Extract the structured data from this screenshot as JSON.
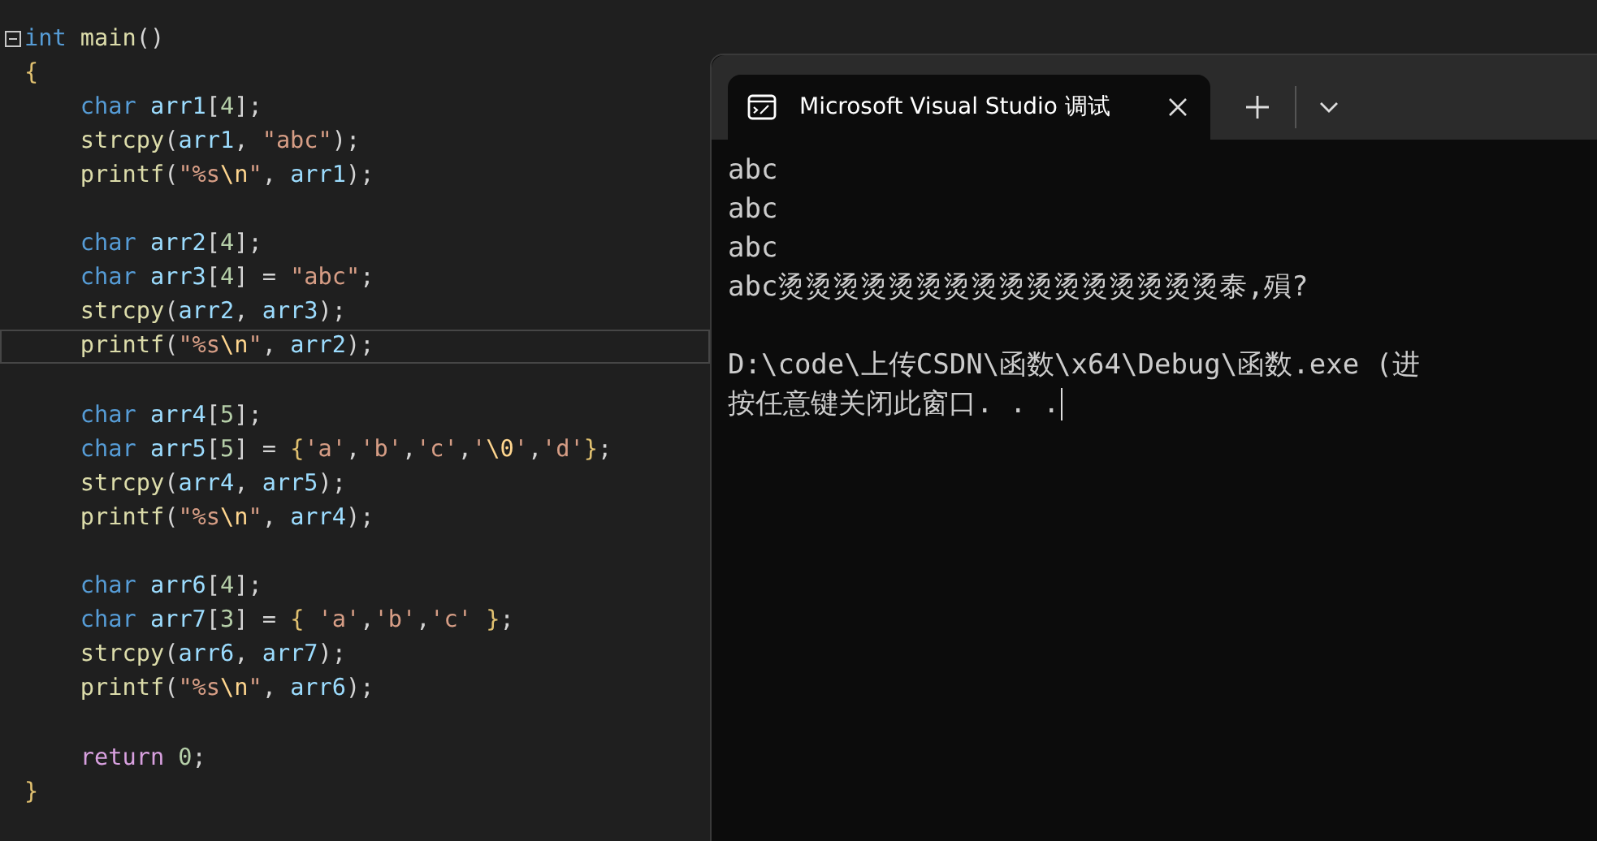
{
  "editor": {
    "lines": [
      {
        "expanded": true,
        "current": false,
        "tokens": [
          {
            "kind": "kw",
            "text": "int"
          },
          {
            "kind": "fn",
            "text": " main"
          },
          {
            "kind": "punc",
            "text": "()"
          }
        ]
      },
      {
        "current": false,
        "tokens": [
          {
            "kind": "brace",
            "text": "{"
          }
        ]
      },
      {
        "current": false,
        "tokens": [
          {
            "kind": "kw",
            "text": "    char"
          },
          {
            "kind": "var",
            "text": " arr1"
          },
          {
            "kind": "punc",
            "text": "["
          },
          {
            "kind": "num",
            "text": "4"
          },
          {
            "kind": "punc",
            "text": "];"
          }
        ]
      },
      {
        "current": false,
        "tokens": [
          {
            "kind": "fn",
            "text": "    strcpy"
          },
          {
            "kind": "punc",
            "text": "("
          },
          {
            "kind": "var",
            "text": "arr1"
          },
          {
            "kind": "punc",
            "text": ", "
          },
          {
            "kind": "str",
            "text": "\"abc\""
          },
          {
            "kind": "punc",
            "text": ");"
          }
        ]
      },
      {
        "current": false,
        "tokens": [
          {
            "kind": "fn",
            "text": "    printf"
          },
          {
            "kind": "punc",
            "text": "("
          },
          {
            "kind": "str",
            "text": "\"%s"
          },
          {
            "kind": "esc",
            "text": "\\n"
          },
          {
            "kind": "str",
            "text": "\""
          },
          {
            "kind": "punc",
            "text": ", "
          },
          {
            "kind": "var",
            "text": "arr1"
          },
          {
            "kind": "punc",
            "text": ");"
          }
        ]
      },
      {
        "current": false
      },
      {
        "current": false,
        "tokens": [
          {
            "kind": "kw",
            "text": "    char"
          },
          {
            "kind": "var",
            "text": " arr2"
          },
          {
            "kind": "punc",
            "text": "["
          },
          {
            "kind": "num",
            "text": "4"
          },
          {
            "kind": "punc",
            "text": "];"
          }
        ]
      },
      {
        "current": false,
        "tokens": [
          {
            "kind": "kw",
            "text": "    char"
          },
          {
            "kind": "var",
            "text": " arr3"
          },
          {
            "kind": "punc",
            "text": "["
          },
          {
            "kind": "num",
            "text": "4"
          },
          {
            "kind": "punc",
            "text": "] = "
          },
          {
            "kind": "str",
            "text": "\"abc\""
          },
          {
            "kind": "punc",
            "text": ";"
          }
        ]
      },
      {
        "current": false,
        "tokens": [
          {
            "kind": "fn",
            "text": "    strcpy"
          },
          {
            "kind": "punc",
            "text": "("
          },
          {
            "kind": "var",
            "text": "arr2"
          },
          {
            "kind": "punc",
            "text": ", "
          },
          {
            "kind": "var",
            "text": "arr3"
          },
          {
            "kind": "punc",
            "text": ");"
          }
        ]
      },
      {
        "current": true,
        "tokens": [
          {
            "kind": "fn",
            "text": "    printf"
          },
          {
            "kind": "punc",
            "text": "("
          },
          {
            "kind": "str",
            "text": "\"%s"
          },
          {
            "kind": "esc",
            "text": "\\n"
          },
          {
            "kind": "str",
            "text": "\""
          },
          {
            "kind": "punc",
            "text": ", "
          },
          {
            "kind": "var",
            "text": "arr2"
          },
          {
            "kind": "punc",
            "text": ");"
          }
        ]
      },
      {
        "current": false
      },
      {
        "current": false,
        "tokens": [
          {
            "kind": "kw",
            "text": "    char"
          },
          {
            "kind": "var",
            "text": " arr4"
          },
          {
            "kind": "punc",
            "text": "["
          },
          {
            "kind": "num",
            "text": "5"
          },
          {
            "kind": "punc",
            "text": "];"
          }
        ]
      },
      {
        "current": false,
        "tokens": [
          {
            "kind": "kw",
            "text": "    char"
          },
          {
            "kind": "var",
            "text": " arr5"
          },
          {
            "kind": "punc",
            "text": "["
          },
          {
            "kind": "num",
            "text": "5"
          },
          {
            "kind": "punc",
            "text": "] = "
          },
          {
            "kind": "brace",
            "text": "{"
          },
          {
            "kind": "str",
            "text": "'a'"
          },
          {
            "kind": "punc",
            "text": ","
          },
          {
            "kind": "str",
            "text": "'b'"
          },
          {
            "kind": "punc",
            "text": ","
          },
          {
            "kind": "str",
            "text": "'c'"
          },
          {
            "kind": "punc",
            "text": ","
          },
          {
            "kind": "str",
            "text": "'"
          },
          {
            "kind": "esc",
            "text": "\\0"
          },
          {
            "kind": "str",
            "text": "'"
          },
          {
            "kind": "punc",
            "text": ","
          },
          {
            "kind": "str",
            "text": "'d'"
          },
          {
            "kind": "brace",
            "text": "}"
          },
          {
            "kind": "punc",
            "text": ";"
          }
        ]
      },
      {
        "current": false,
        "tokens": [
          {
            "kind": "fn",
            "text": "    strcpy"
          },
          {
            "kind": "punc",
            "text": "("
          },
          {
            "kind": "var",
            "text": "arr4"
          },
          {
            "kind": "punc",
            "text": ", "
          },
          {
            "kind": "var",
            "text": "arr5"
          },
          {
            "kind": "punc",
            "text": ");"
          }
        ]
      },
      {
        "current": false,
        "tokens": [
          {
            "kind": "fn",
            "text": "    printf"
          },
          {
            "kind": "punc",
            "text": "("
          },
          {
            "kind": "str",
            "text": "\"%s"
          },
          {
            "kind": "esc",
            "text": "\\n"
          },
          {
            "kind": "str",
            "text": "\""
          },
          {
            "kind": "punc",
            "text": ", "
          },
          {
            "kind": "var",
            "text": "arr4"
          },
          {
            "kind": "punc",
            "text": ");"
          }
        ]
      },
      {
        "current": false
      },
      {
        "current": false,
        "tokens": [
          {
            "kind": "kw",
            "text": "    char"
          },
          {
            "kind": "var",
            "text": " arr6"
          },
          {
            "kind": "punc",
            "text": "["
          },
          {
            "kind": "num",
            "text": "4"
          },
          {
            "kind": "punc",
            "text": "];"
          }
        ]
      },
      {
        "current": false,
        "tokens": [
          {
            "kind": "kw",
            "text": "    char"
          },
          {
            "kind": "var",
            "text": " arr7"
          },
          {
            "kind": "punc",
            "text": "["
          },
          {
            "kind": "num",
            "text": "3"
          },
          {
            "kind": "punc",
            "text": "] = "
          },
          {
            "kind": "brace",
            "text": "{"
          },
          {
            "kind": "str",
            "text": " 'a'"
          },
          {
            "kind": "punc",
            "text": ","
          },
          {
            "kind": "str",
            "text": "'b'"
          },
          {
            "kind": "punc",
            "text": ","
          },
          {
            "kind": "str",
            "text": "'c'"
          },
          {
            "kind": "brace",
            "text": " }"
          },
          {
            "kind": "punc",
            "text": ";"
          }
        ]
      },
      {
        "current": false,
        "tokens": [
          {
            "kind": "fn",
            "text": "    strcpy"
          },
          {
            "kind": "punc",
            "text": "("
          },
          {
            "kind": "var",
            "text": "arr6"
          },
          {
            "kind": "punc",
            "text": ", "
          },
          {
            "kind": "var",
            "text": "arr7"
          },
          {
            "kind": "punc",
            "text": ");"
          }
        ]
      },
      {
        "current": false,
        "tokens": [
          {
            "kind": "fn",
            "text": "    printf"
          },
          {
            "kind": "punc",
            "text": "("
          },
          {
            "kind": "str",
            "text": "\"%s"
          },
          {
            "kind": "esc",
            "text": "\\n"
          },
          {
            "kind": "str",
            "text": "\""
          },
          {
            "kind": "punc",
            "text": ", "
          },
          {
            "kind": "var",
            "text": "arr6"
          },
          {
            "kind": "punc",
            "text": ");"
          }
        ]
      },
      {
        "current": false
      },
      {
        "current": false,
        "tokens": [
          {
            "kind": "ctrl",
            "text": "    return"
          },
          {
            "kind": "num",
            "text": " 0"
          },
          {
            "kind": "punc",
            "text": ";"
          }
        ]
      },
      {
        "current": false,
        "tokens": [
          {
            "kind": "brace",
            "text": "}"
          }
        ]
      }
    ]
  },
  "terminal": {
    "tab": {
      "title": "Microsoft Visual Studio 调试",
      "selected": true
    },
    "program_output": [
      "abc",
      "abc",
      "abc",
      "abc烫烫烫烫烫烫烫烫烫烫烫烫烫烫烫烫泰,殞?"
    ],
    "exit_message": [
      "D:\\code\\上传CSDN\\函数\\x64\\Debug\\函数.exe (进",
      "按任意键关闭此窗口. . ."
    ]
  }
}
